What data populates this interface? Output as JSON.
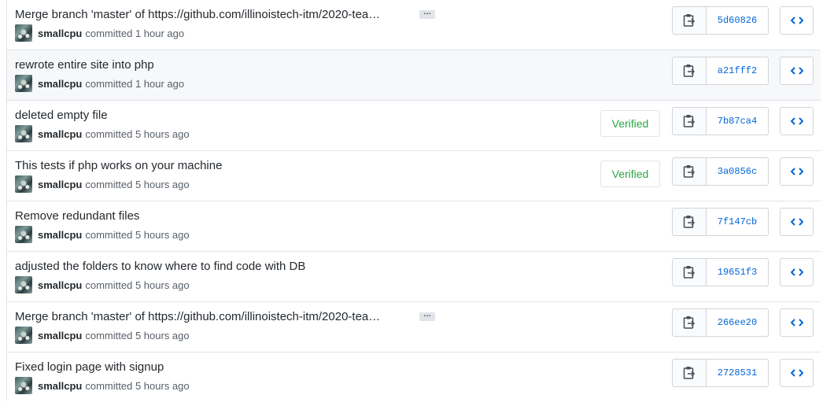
{
  "commits": [
    {
      "title": "Merge branch 'master' of https://github.com/illinoistech-itm/2020-tea…",
      "has_ellipsis": true,
      "ellipsis_label": "…",
      "author": "smallcpu",
      "action": "committed",
      "time": "1 hour ago",
      "verified": "",
      "sha": "5d60826"
    },
    {
      "title": "rewrote entire site into php",
      "has_ellipsis": false,
      "ellipsis_label": "",
      "author": "smallcpu",
      "action": "committed",
      "time": "1 hour ago",
      "verified": "",
      "sha": "a21fff2"
    },
    {
      "title": "deleted empty file",
      "has_ellipsis": false,
      "ellipsis_label": "",
      "author": "smallcpu",
      "action": "committed",
      "time": "5 hours ago",
      "verified": "Verified",
      "sha": "7b87ca4"
    },
    {
      "title": "This tests if php works on your machine",
      "has_ellipsis": false,
      "ellipsis_label": "",
      "author": "smallcpu",
      "action": "committed",
      "time": "5 hours ago",
      "verified": "Verified",
      "sha": "3a0856c"
    },
    {
      "title": "Remove redundant files",
      "has_ellipsis": false,
      "ellipsis_label": "",
      "author": "smallcpu",
      "action": "committed",
      "time": "5 hours ago",
      "verified": "",
      "sha": "7f147cb"
    },
    {
      "title": "adjusted the folders to know where to find code with DB",
      "has_ellipsis": false,
      "ellipsis_label": "",
      "author": "smallcpu",
      "action": "committed",
      "time": "5 hours ago",
      "verified": "",
      "sha": "19651f3"
    },
    {
      "title": "Merge branch 'master' of https://github.com/illinoistech-itm/2020-tea…",
      "has_ellipsis": true,
      "ellipsis_label": "…",
      "author": "smallcpu",
      "action": "committed",
      "time": "5 hours ago",
      "verified": "",
      "sha": "266ee20"
    },
    {
      "title": "Fixed login page with signup",
      "has_ellipsis": false,
      "ellipsis_label": "",
      "author": "smallcpu",
      "action": "committed",
      "time": "5 hours ago",
      "verified": "",
      "sha": "2728531"
    }
  ],
  "icons": {
    "copy": "clippy-icon",
    "browse": "code-icon"
  },
  "colors": {
    "link": "#0366d6",
    "verified": "#28a745",
    "border": "#e1e4e8",
    "hover_bg": "#f6f8fa"
  }
}
